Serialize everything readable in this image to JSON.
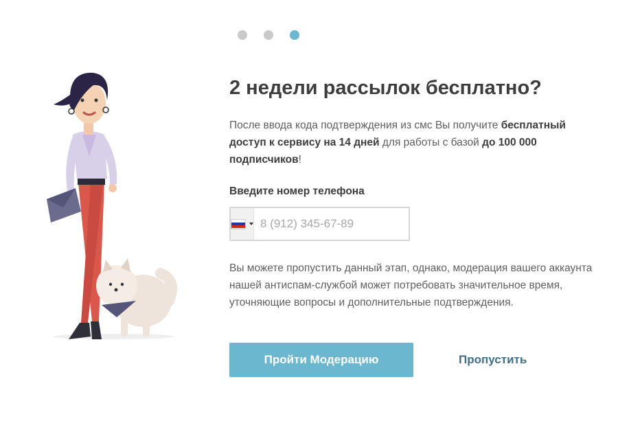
{
  "progress": {
    "total": 3,
    "current": 3
  },
  "colors": {
    "accent": "#6ab7cf",
    "skip_link": "#3f6f84",
    "dot_inactive": "#c9c9c9"
  },
  "title": "2 недели рассылок бесплатно?",
  "description": {
    "part1": "После ввода кода подтверждения из смс Вы получите ",
    "bold1": "бесплатный доступ к сервису на 14 дней",
    "part2": " для работы с базой ",
    "bold2": "до 100 000 подписчиков",
    "part3": "!"
  },
  "phone": {
    "label": "Введите номер телефона",
    "placeholder": "8 (912) 345-67-89",
    "value": "",
    "country_icon": "flag-russia-icon"
  },
  "note": "Вы можете пропустить данный этап, однако, модерация вашего аккаунта нашей антиспам-службой может потребовать значительное время, уточняющие вопросы и дополнительные подтверждения.",
  "actions": {
    "primary_label": "Пройти Модерацию",
    "skip_label": "Пропустить"
  }
}
